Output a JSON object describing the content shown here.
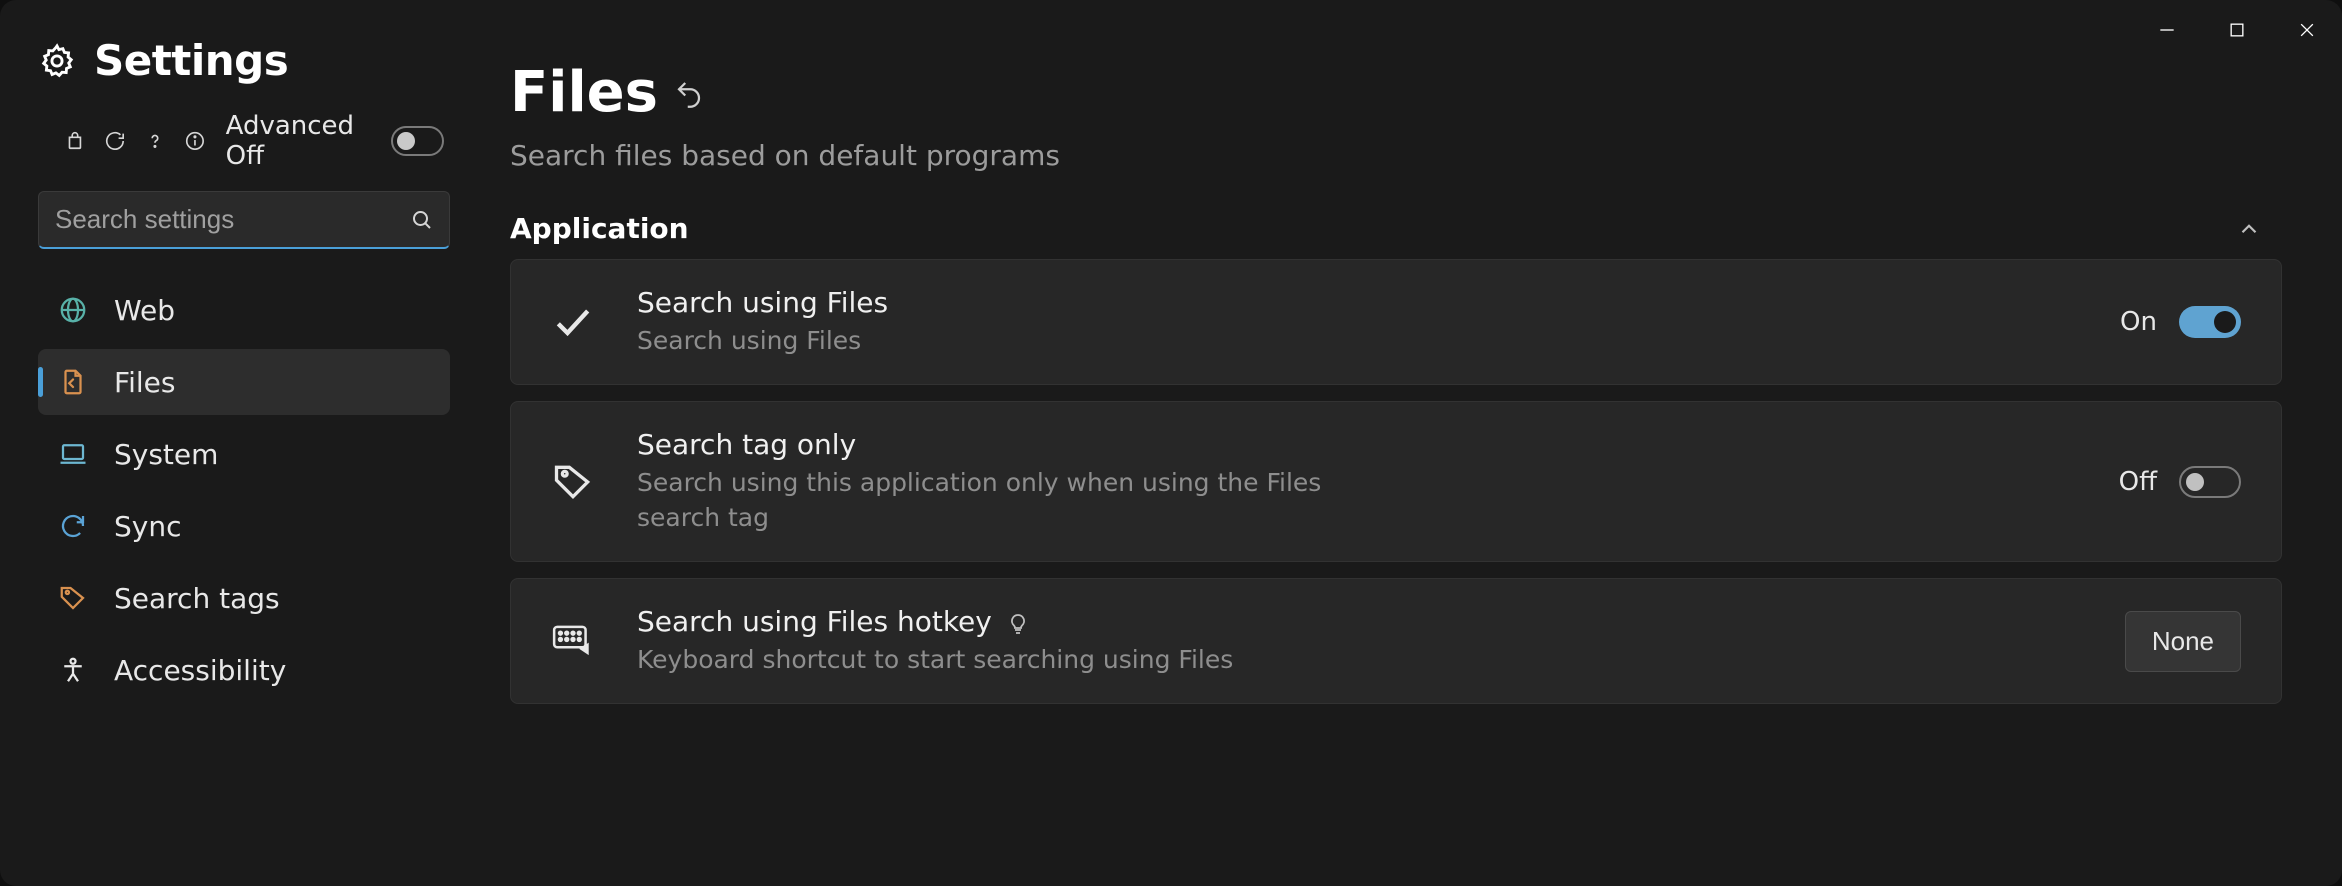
{
  "header": {
    "title": "Settings",
    "advanced_label": "Advanced Off",
    "advanced_on": false
  },
  "search": {
    "placeholder": "Search settings",
    "value": ""
  },
  "nav": {
    "items": [
      {
        "id": "web",
        "label": "Web"
      },
      {
        "id": "files",
        "label": "Files"
      },
      {
        "id": "system",
        "label": "System"
      },
      {
        "id": "sync",
        "label": "Sync"
      },
      {
        "id": "search-tags",
        "label": "Search tags"
      },
      {
        "id": "accessibility",
        "label": "Accessibility"
      }
    ],
    "active": "files"
  },
  "page": {
    "title": "Files",
    "subtitle": "Search files based on default programs"
  },
  "section": {
    "title": "Application"
  },
  "settings": [
    {
      "title": "Search using Files",
      "sub": "Search using Files",
      "state_label": "On",
      "on": true
    },
    {
      "title": "Search tag only",
      "sub": "Search using this application only when using the Files search tag",
      "state_label": "Off",
      "on": false
    },
    {
      "title": "Search using Files hotkey",
      "sub": "Keyboard shortcut to start searching using Files",
      "hotkey": "None"
    }
  ]
}
